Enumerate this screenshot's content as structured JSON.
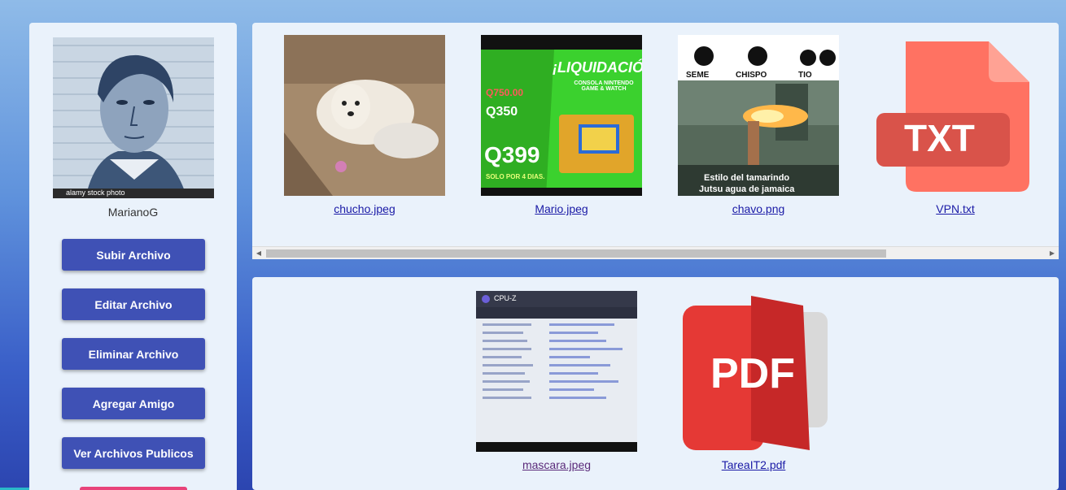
{
  "sidebar": {
    "avatar_watermark": "alamy stock photo",
    "username": "MarianoG",
    "buttons": [
      {
        "label": "Subir Archivo"
      },
      {
        "label": "Editar Archivo"
      },
      {
        "label": "Eliminar Archivo"
      },
      {
        "label": "Agregar Amigo"
      },
      {
        "label": "Ver Archivos Publicos"
      }
    ]
  },
  "my_files": [
    {
      "name": "chucho.jpeg",
      "kind": "photo"
    },
    {
      "name": "Mario.jpeg",
      "kind": "photo"
    },
    {
      "name": "chavo.png",
      "kind": "photo"
    },
    {
      "name": "VPN.txt",
      "kind": "txt-icon"
    }
  ],
  "shared_files": [
    {
      "name": "mascara.jpeg",
      "kind": "photo"
    },
    {
      "name": "TareaIT2.pdf",
      "kind": "pdf-icon"
    }
  ],
  "thumb_text": {
    "mario_headline": "¡LIQUIDACIÓN!",
    "mario_sub": "CONSOLA NINTENDO GAME & WATCH",
    "mario_price_old": "Q750.00",
    "mario_price_mid": "Q350",
    "mario_price": "Q399",
    "mario_days": "SOLO POR 4 DIAS.",
    "chavo_labels": [
      "SEME",
      "CHISPO",
      "TIO"
    ],
    "chavo_caption1": "Estilo del tamarindo",
    "chavo_caption2": "Jutsu agua de jamaica",
    "txt_label": "TXT",
    "pdf_label": "PDF",
    "mascara_app": "CPU-Z"
  },
  "colors": {
    "button": "#3f51b5",
    "panel": "#eaf2fb",
    "link": "#1a1aa6",
    "txt_icon": "#ff7262",
    "pdf_icon": "#e53935"
  }
}
